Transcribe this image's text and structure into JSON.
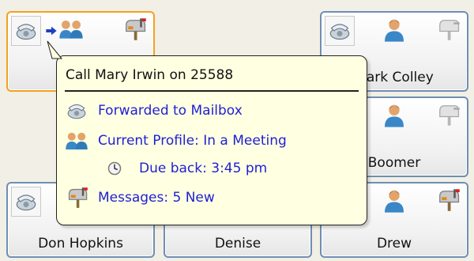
{
  "cards": [
    {
      "id": "mary",
      "name": ""
    },
    {
      "id": "mark",
      "name": "Mark Colley"
    },
    {
      "id": "boomer",
      "name": "Boomer"
    },
    {
      "id": "don",
      "name": "Don Hopkins"
    },
    {
      "id": "denise",
      "name": "Denise"
    },
    {
      "id": "drew",
      "name": "Drew"
    }
  ],
  "tooltip": {
    "title": "Call Mary Irwin on 25588",
    "forward": "Forwarded to Mailbox",
    "profile": "Current Profile: In a Meeting",
    "due_back": "Due back: 3:45 pm",
    "messages": "Messages: 5 New"
  },
  "colors": {
    "card_border": "#6f8fb3",
    "active_border": "#f3a21c",
    "tooltip_bg": "#ffffe1",
    "link_text": "#1f1fd6"
  },
  "icons": [
    "phone-icon",
    "forward-arrow-icon",
    "group-icon",
    "person-icon",
    "mailbox-icon",
    "clock-icon"
  ]
}
